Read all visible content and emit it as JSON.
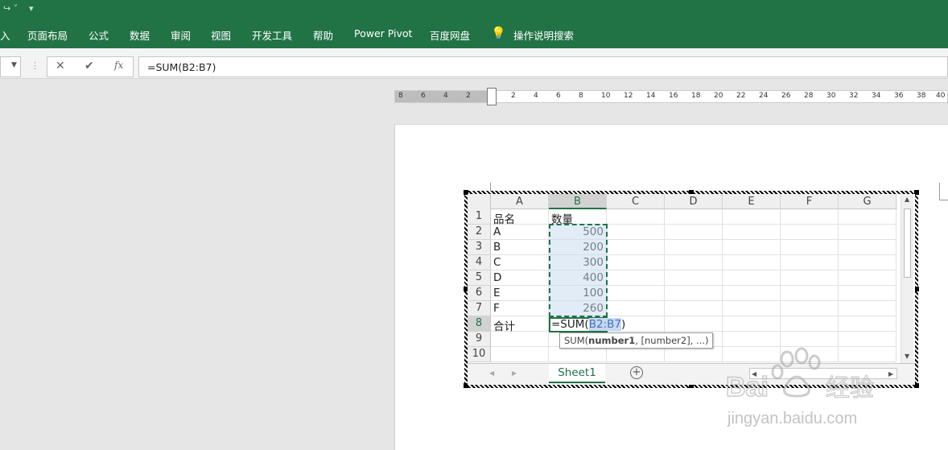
{
  "quick_access": {
    "redo_icon": "redo-icon",
    "customize_icon": "customize-icon"
  },
  "ribbon": {
    "tabs": [
      "入",
      "页面布局",
      "公式",
      "数据",
      "审阅",
      "视图",
      "开发工具",
      "帮助",
      "Power Pivot",
      "百度网盘",
      "操作说明搜索"
    ],
    "search_icon": "lightbulb-icon"
  },
  "formula_bar": {
    "value": "=SUM(B2:B7)",
    "fx_label": "fx"
  },
  "ruler": {
    "ticks": [
      "8",
      "6",
      "4",
      "2",
      "2",
      "4",
      "6",
      "8",
      "10",
      "12",
      "14",
      "16",
      "18",
      "20",
      "22",
      "24",
      "26",
      "28",
      "30",
      "32",
      "34",
      "36",
      "38",
      "40"
    ]
  },
  "sheet": {
    "columns": [
      "A",
      "B",
      "C",
      "D",
      "E",
      "F",
      "G"
    ],
    "rows": [
      "1",
      "2",
      "3",
      "4",
      "5",
      "6",
      "7",
      "8",
      "9",
      "10"
    ],
    "cells": [
      [
        "品名",
        "数量"
      ],
      [
        "A",
        "500"
      ],
      [
        "B",
        "200"
      ],
      [
        "C",
        "300"
      ],
      [
        "D",
        "400"
      ],
      [
        "E",
        "100"
      ],
      [
        "F",
        "260"
      ],
      [
        "合计",
        ""
      ]
    ],
    "active_formula_prefix": "=SUM(",
    "active_formula_ref": "B2:B7",
    "active_formula_suffix": ")",
    "tooltip_prefix": "SUM(",
    "tooltip_bold": "number1",
    "tooltip_rest": ", [number2], ...)",
    "sheet_tab": "Sheet1",
    "add_sheet": "⊕"
  },
  "watermark": {
    "text1": "Baidu 经验",
    "text2": "jingyan.baidu.com"
  },
  "colors": {
    "excel_green": "#217346",
    "selection": "#c6d9f0"
  }
}
